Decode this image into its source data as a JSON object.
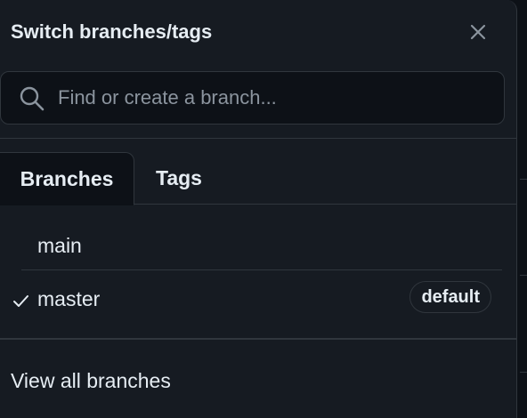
{
  "panel": {
    "title": "Switch branches/tags",
    "close_icon": "close-icon"
  },
  "search": {
    "placeholder": "Find or create a branch...",
    "value": "",
    "icon": "search-icon"
  },
  "tabs": [
    {
      "label": "Branches",
      "selected": true
    },
    {
      "label": "Tags",
      "selected": false
    }
  ],
  "branches": [
    {
      "name": "main",
      "checked": false,
      "badge": ""
    },
    {
      "name": "master",
      "checked": true,
      "badge": "default"
    }
  ],
  "footer": {
    "view_all_label": "View all branches"
  },
  "colors": {
    "background": "#0d1117",
    "panel": "#161b22",
    "border": "#30363d",
    "text": "#e6edf3",
    "muted": "#8b949e"
  }
}
